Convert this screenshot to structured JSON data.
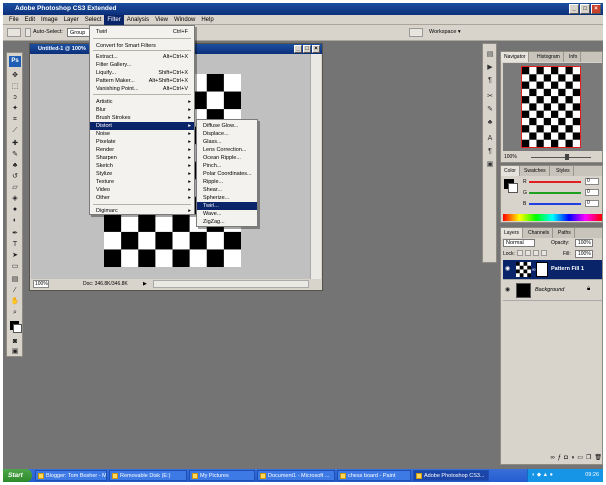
{
  "app": {
    "title": "Adobe Photoshop CS3 Extended",
    "menus": [
      "File",
      "Edit",
      "Image",
      "Layer",
      "Select",
      "Filter",
      "Analysis",
      "View",
      "Window",
      "Help"
    ],
    "active_menu": "Filter"
  },
  "options_bar": {
    "auto_select_label": "Auto-Select:",
    "auto_select_value": "Group",
    "workspace_label": "Workspace ▾"
  },
  "document": {
    "title": "Untitled-1 @ 100%",
    "zoom": "100%",
    "doc_size": "Doc: 346.8K/346.8K"
  },
  "filter_menu": {
    "items": [
      {
        "label": "Twirl",
        "shortcut": "Ctrl+F"
      },
      {
        "label": "Convert for Smart Filters"
      },
      {
        "label": "Extract...",
        "shortcut": "Alt+Ctrl+X"
      },
      {
        "label": "Filter Gallery..."
      },
      {
        "label": "Liquify...",
        "shortcut": "Shift+Ctrl+X"
      },
      {
        "label": "Pattern Maker...",
        "shortcut": "Alt+Shift+Ctrl+X"
      },
      {
        "label": "Vanishing Point...",
        "shortcut": "Alt+Ctrl+V"
      },
      {
        "label": "Artistic"
      },
      {
        "label": "Blur"
      },
      {
        "label": "Brush Strokes"
      },
      {
        "label": "Distort"
      },
      {
        "label": "Noise"
      },
      {
        "label": "Pixelate"
      },
      {
        "label": "Render"
      },
      {
        "label": "Sharpen"
      },
      {
        "label": "Sketch"
      },
      {
        "label": "Stylize"
      },
      {
        "label": "Texture"
      },
      {
        "label": "Video"
      },
      {
        "label": "Other"
      },
      {
        "label": "Digimarc"
      }
    ],
    "highlighted": "Distort"
  },
  "distort_submenu": {
    "items": [
      {
        "label": "Diffuse Glow..."
      },
      {
        "label": "Displace..."
      },
      {
        "label": "Glass..."
      },
      {
        "label": "Lens Correction..."
      },
      {
        "label": "Ocean Ripple..."
      },
      {
        "label": "Pinch..."
      },
      {
        "label": "Polar Coordinates..."
      },
      {
        "label": "Ripple..."
      },
      {
        "label": "Shear..."
      },
      {
        "label": "Spherize..."
      },
      {
        "label": "Twirl..."
      },
      {
        "label": "Wave..."
      },
      {
        "label": "ZigZag..."
      }
    ],
    "highlighted": "Twirl..."
  },
  "navigator_panel": {
    "tabs": [
      "Navigator",
      "Histogram",
      "Info"
    ],
    "zoom": "100%"
  },
  "color_panel": {
    "tabs": [
      "Color",
      "Swatches",
      "Styles"
    ],
    "channels": [
      {
        "label": "R",
        "value": "0",
        "color": "#e02020"
      },
      {
        "label": "G",
        "value": "0",
        "color": "#20a020"
      },
      {
        "label": "B",
        "value": "0",
        "color": "#2040e0"
      }
    ]
  },
  "layers_panel": {
    "tabs": [
      "Layers",
      "Channels",
      "Paths"
    ],
    "blend_mode": "Normal",
    "opacity_label": "Opacity:",
    "opacity_value": "100%",
    "lock_label": "Lock:",
    "fill_label": "Fill:",
    "fill_value": "100%",
    "layers": [
      {
        "name": "Pattern Fill 1",
        "selected": true
      },
      {
        "name": "Background",
        "selected": false
      }
    ]
  },
  "taskbar": {
    "start_label": "Start",
    "tasks": [
      {
        "label": "Blogger: Tom Bosher - M...",
        "active": false
      },
      {
        "label": "Removable Disk (E:)",
        "active": false
      },
      {
        "label": "My Pictures",
        "active": false
      },
      {
        "label": "Document1 - Microsoft ...",
        "active": false
      },
      {
        "label": "chess board - Paint",
        "active": false
      },
      {
        "label": "Adobe Photoshop CS3...",
        "active": true
      }
    ],
    "clock": "09:26"
  },
  "colors": {
    "accent": "#0a246a",
    "chrome": "#d8d4cc",
    "workspace": "#747474"
  }
}
